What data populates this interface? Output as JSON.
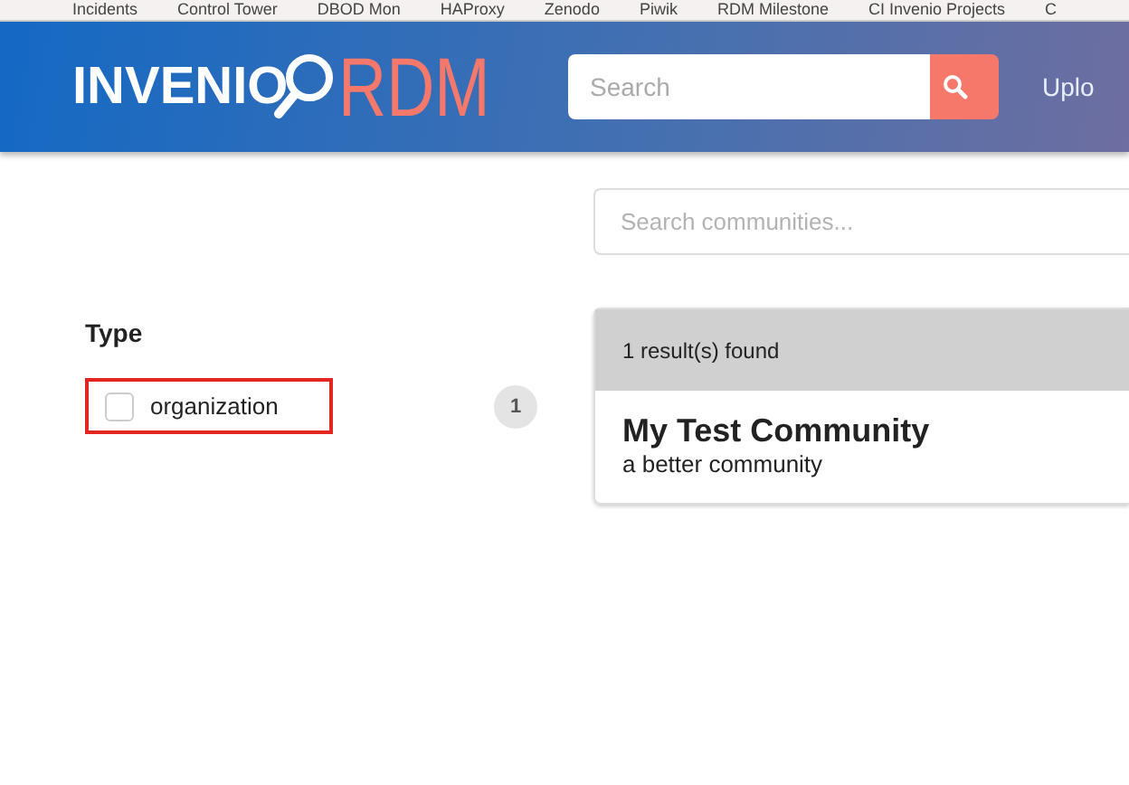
{
  "bookmarks_bar": {
    "items": [
      "Incidents",
      "Control Tower",
      "DBOD Mon",
      "HAProxy",
      "Zenodo",
      "Piwik",
      "RDM Milestone",
      "CI Invenio Projects",
      "C"
    ]
  },
  "header": {
    "logo": {
      "word": "INVENIO",
      "accent": "RDM"
    },
    "search": {
      "placeholder": "Search"
    },
    "nav": [
      "Uplo"
    ]
  },
  "community_search": {
    "placeholder": "Search communities..."
  },
  "facets": {
    "title": "Type",
    "items": [
      {
        "label": "organization",
        "count": "1",
        "checked": false,
        "highlighted": true
      }
    ]
  },
  "results": {
    "summary": "1 result(s) found",
    "items": [
      {
        "title": "My Test Community",
        "description": "a better community"
      }
    ]
  }
}
